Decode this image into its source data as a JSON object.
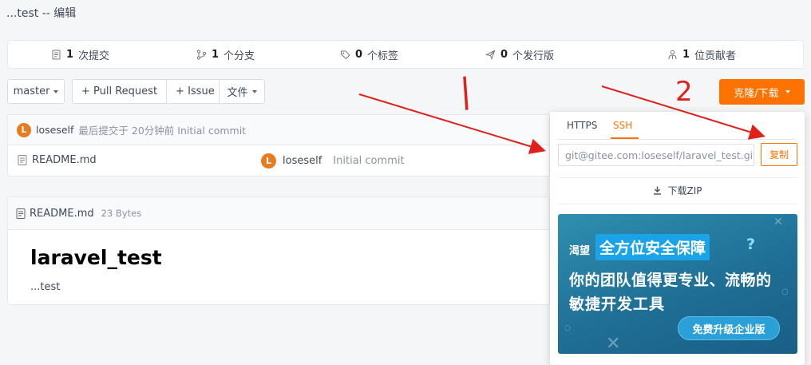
{
  "repo": {
    "description": "...test -- 编辑"
  },
  "stats": {
    "commits_count": "1",
    "commits_label": "次提交",
    "branches_count": "1",
    "branches_label": "个分支",
    "tags_count": "0",
    "tags_label": "个标签",
    "releases_count": "0",
    "releases_label": "个发行版",
    "contributors_count": "1",
    "contributors_label": "位贡献者"
  },
  "toolbar": {
    "branch": "master",
    "pull_request": "+ Pull Request",
    "issue": "+ Issue",
    "file_menu": "文件",
    "clone_download": "克隆/下载"
  },
  "last_commit": {
    "avatar_letter": "L",
    "author": "loseself",
    "text": "最后提交于 20分钟前 Initial commit"
  },
  "files": [
    {
      "name": "README.md",
      "avatar_letter": "L",
      "author": "loseself",
      "message": "Initial commit"
    }
  ],
  "readme": {
    "filename": "README.md",
    "size": "23 Bytes",
    "title": "laravel_test",
    "body": "...test"
  },
  "clone_popup": {
    "tabs": [
      "HTTPS",
      "SSH"
    ],
    "active_tab": "SSH",
    "url": "git@gitee.com:loseself/laravel_test.git",
    "copy": "复制",
    "download_zip": "下载ZIP"
  },
  "banner": {
    "small": "渴望",
    "highlight": "全方位安全保障",
    "q": "?",
    "line2": "你的团队值得更专业、流畅的",
    "line3": "敏捷开发工具",
    "cta": "免费升级企业版"
  },
  "annotations": {
    "mark1": "|",
    "mark2": "2"
  },
  "colors": {
    "accent": "#fe7300",
    "annotation": "#e0201a"
  }
}
